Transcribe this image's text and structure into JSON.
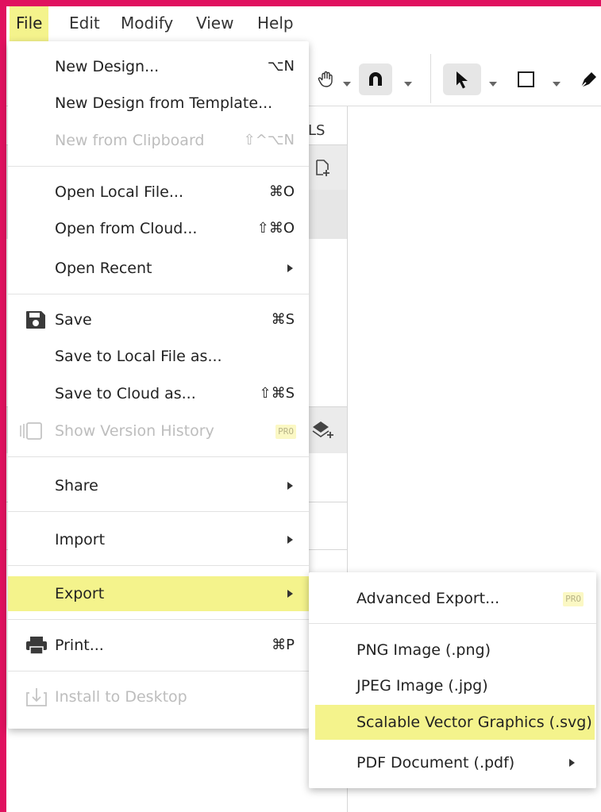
{
  "menubar": {
    "items": [
      "File",
      "Edit",
      "Modify",
      "View",
      "Help"
    ],
    "active": "File"
  },
  "panel": {
    "tab_label_fragment": "LS"
  },
  "file_menu": {
    "new_design": {
      "label": "New Design...",
      "shortcut": "⌥N"
    },
    "new_from_template": {
      "label": "New Design from Template..."
    },
    "new_from_clipboard": {
      "label": "New from Clipboard",
      "shortcut": "⇧^⌥N"
    },
    "open_local": {
      "label": "Open Local File...",
      "shortcut": "⌘O"
    },
    "open_cloud": {
      "label": "Open from Cloud...",
      "shortcut": "⇧⌘O"
    },
    "open_recent": {
      "label": "Open Recent"
    },
    "save": {
      "label": "Save",
      "shortcut": "⌘S",
      "icon": "floppy-disk-icon"
    },
    "save_local_as": {
      "label": "Save to Local File as..."
    },
    "save_cloud_as": {
      "label": "Save to Cloud as...",
      "shortcut": "⇧⌘S"
    },
    "version_history": {
      "label": "Show Version History",
      "badge": "PRO",
      "icon": "version-history-icon"
    },
    "share": {
      "label": "Share"
    },
    "import": {
      "label": "Import"
    },
    "export": {
      "label": "Export"
    },
    "print": {
      "label": "Print...",
      "shortcut": "⌘P",
      "icon": "printer-icon"
    },
    "install": {
      "label": "Install to Desktop",
      "icon": "install-icon"
    }
  },
  "export_submenu": {
    "advanced": {
      "label": "Advanced Export...",
      "badge": "PRO"
    },
    "png": {
      "label": "PNG Image (.png)"
    },
    "jpeg": {
      "label": "JPEG Image (.jpg)"
    },
    "svg": {
      "label": "Scalable Vector Graphics (.svg)"
    },
    "pdf": {
      "label": "PDF Document (.pdf)"
    }
  },
  "colors": {
    "highlight": "#f4f38c",
    "frame": "#e0115f",
    "disabled_text": "#bdbdbd",
    "pro_badge_bg": "#fbf8c4"
  }
}
